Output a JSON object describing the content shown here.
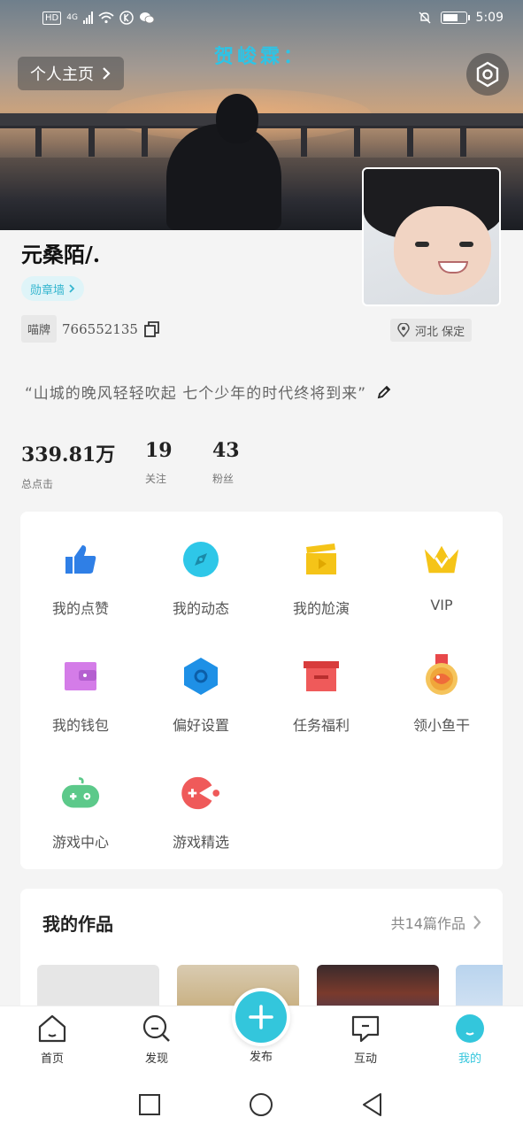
{
  "status_bar": {
    "network_type": "HD",
    "network_gen": "4G",
    "time": "5:09"
  },
  "hero": {
    "title": "贺峻霖：",
    "home_button_label": "个人主页"
  },
  "profile": {
    "username": "元桑陌/.",
    "badge_wall_label": "勋章墙",
    "tag_label": "喵牌",
    "user_id": "766552135",
    "location": "河北 保定",
    "signature": "“山城的晚风轻轻吹起 七个少年的时代终将到来”"
  },
  "stats": [
    {
      "value": "339.81万",
      "label": "总点击"
    },
    {
      "value": "19",
      "label": "关注"
    },
    {
      "value": "43",
      "label": "粉丝"
    }
  ],
  "features": [
    {
      "label": "我的点赞",
      "icon": "thumbs-up-icon",
      "color": "#2f7fe6"
    },
    {
      "label": "我的动态",
      "icon": "compass-icon",
      "color": "#2ec7e8"
    },
    {
      "label": "我的尬演",
      "icon": "clapperboard-icon",
      "color": "#f5c418"
    },
    {
      "label": "VIP",
      "icon": "crown-icon",
      "color": "#f5c418"
    },
    {
      "label": "我的钱包",
      "icon": "wallet-icon",
      "color": "#d47ce8"
    },
    {
      "label": "偏好设置",
      "icon": "hexagon-gear-icon",
      "color": "#1e90e6"
    },
    {
      "label": "任务福利",
      "icon": "gift-box-icon",
      "color": "#ef5a5a"
    },
    {
      "label": "领小鱼干",
      "icon": "medal-icon",
      "color": "#f0a63a"
    },
    {
      "label": "游戏中心",
      "icon": "gamepad-icon",
      "color": "#5cc98a"
    },
    {
      "label": "游戏精选",
      "icon": "pacman-icon",
      "color": "#ef5a5a"
    }
  ],
  "works": {
    "title": "我的作品",
    "count_label": "共14篇作品"
  },
  "bottom_nav": [
    {
      "label": "首页",
      "icon": "home-icon"
    },
    {
      "label": "发现",
      "icon": "discover-search-icon"
    },
    {
      "label": "发布",
      "icon": "plus-icon"
    },
    {
      "label": "互动",
      "icon": "message-icon"
    },
    {
      "label": "我的",
      "icon": "profile-icon",
      "active": true
    }
  ],
  "colors": {
    "accent": "#33c6dc",
    "background": "#f4f4f4"
  }
}
